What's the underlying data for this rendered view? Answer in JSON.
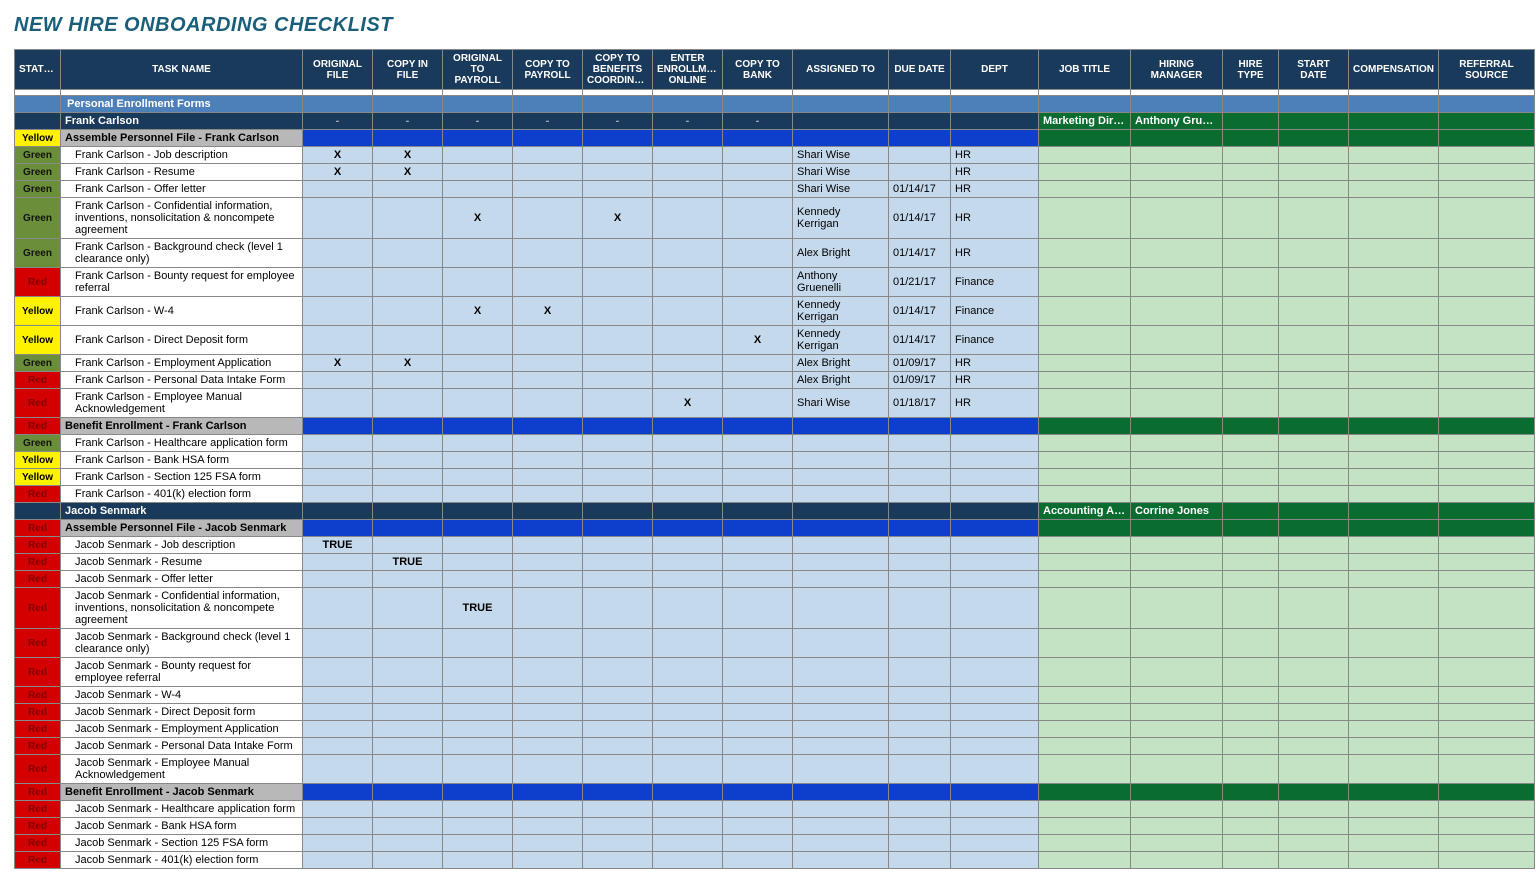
{
  "title": "NEW HIRE ONBOARDING CHECKLIST",
  "columns": [
    "STATUS",
    "TASK NAME",
    "ORIGINAL FILE",
    "COPY IN FILE",
    "ORIGINAL TO PAYROLL",
    "COPY TO PAYROLL",
    "COPY TO BENEFITS COORDINATOR",
    "ENTER ENROLLMENT ONLINE",
    "COPY TO BANK",
    "ASSIGNED TO",
    "DUE DATE",
    "DEPT",
    "JOB TITLE",
    "HIRING MANAGER",
    "HIRE TYPE",
    "START DATE",
    "COMPENSATION",
    "REFERRAL SOURCE"
  ],
  "col_classes": [
    "col-status",
    "col-task",
    "col-check",
    "col-check",
    "col-check",
    "col-check",
    "col-check",
    "col-check",
    "col-check",
    "col-assigned",
    "col-due",
    "col-dept",
    "col-job",
    "col-hmgr",
    "col-htype",
    "col-sdate",
    "col-comp",
    "col-ref"
  ],
  "section_label": "Personal Enrollment Forms",
  "persons": [
    {
      "name": "Frank Carlson",
      "job_title": "Marketing Director",
      "hiring_manager": "Anthony Gruenelli",
      "dash": "-",
      "groups": [
        {
          "status": "Yellow",
          "label": "Assemble Personnel File - Frank Carlson",
          "rows": [
            {
              "status": "Green",
              "task": "Frank Carlson - Job description",
              "checks": [
                "X",
                "X",
                "",
                "",
                "",
                "",
                ""
              ],
              "assigned": "Shari Wise",
              "due": "",
              "dept": "HR"
            },
            {
              "status": "Green",
              "task": "Frank Carlson - Resume",
              "checks": [
                "X",
                "X",
                "",
                "",
                "",
                "",
                ""
              ],
              "assigned": "Shari Wise",
              "due": "",
              "dept": "HR"
            },
            {
              "status": "Green",
              "task": "Frank Carlson - Offer letter",
              "checks": [
                "",
                "",
                "",
                "",
                "",
                "",
                ""
              ],
              "assigned": "Shari Wise",
              "due": "01/14/17",
              "dept": "HR"
            },
            {
              "status": "Green",
              "task": "Frank Carlson - Confidential information, inventions, nonsolicitation & noncompete agreement",
              "checks": [
                "",
                "",
                "X",
                "",
                "X",
                "",
                ""
              ],
              "assigned": "Kennedy Kerrigan",
              "due": "01/14/17",
              "dept": "HR"
            },
            {
              "status": "Green",
              "task": "Frank Carlson - Background check (level 1 clearance only)",
              "checks": [
                "",
                "",
                "",
                "",
                "",
                "",
                ""
              ],
              "assigned": "Alex Bright",
              "due": "01/14/17",
              "dept": "HR"
            },
            {
              "status": "Red",
              "task": "Frank Carlson - Bounty request for employee referral",
              "checks": [
                "",
                "",
                "",
                "",
                "",
                "",
                ""
              ],
              "assigned": "Anthony Gruenelli",
              "due": "01/21/17",
              "dept": "Finance"
            },
            {
              "status": "Yellow",
              "task": "Frank Carlson - W-4",
              "checks": [
                "",
                "",
                "X",
                "X",
                "",
                "",
                ""
              ],
              "assigned": "Kennedy Kerrigan",
              "due": "01/14/17",
              "dept": "Finance"
            },
            {
              "status": "Yellow",
              "task": "Frank Carlson - Direct Deposit form",
              "checks": [
                "",
                "",
                "",
                "",
                "",
                "",
                "X"
              ],
              "assigned": "Kennedy Kerrigan",
              "due": "01/14/17",
              "dept": "Finance"
            },
            {
              "status": "Green",
              "task": "Frank Carlson - Employment Application",
              "checks": [
                "X",
                "X",
                "",
                "",
                "",
                "",
                ""
              ],
              "assigned": "Alex Bright",
              "due": "01/09/17",
              "dept": "HR"
            },
            {
              "status": "Red",
              "task": "Frank Carlson - Personal Data Intake Form",
              "checks": [
                "",
                "",
                "",
                "",
                "",
                "",
                ""
              ],
              "assigned": "Alex Bright",
              "due": "01/09/17",
              "dept": "HR"
            },
            {
              "status": "Red",
              "task": "Frank Carlson - Employee Manual Acknowledgement",
              "checks": [
                "",
                "",
                "",
                "",
                "",
                "X",
                ""
              ],
              "assigned": "Shari Wise",
              "due": "01/18/17",
              "dept": "HR"
            }
          ]
        },
        {
          "status": "Red",
          "label": "Benefit Enrollment - Frank Carlson",
          "rows": [
            {
              "status": "Green",
              "task": "Frank Carlson - Healthcare application form",
              "checks": [
                "",
                "",
                "",
                "",
                "",
                "",
                ""
              ],
              "assigned": "",
              "due": "",
              "dept": ""
            },
            {
              "status": "Yellow",
              "task": "Frank Carlson - Bank HSA form",
              "checks": [
                "",
                "",
                "",
                "",
                "",
                "",
                ""
              ],
              "assigned": "",
              "due": "",
              "dept": ""
            },
            {
              "status": "Yellow",
              "task": "Frank Carlson - Section 125 FSA form",
              "checks": [
                "",
                "",
                "",
                "",
                "",
                "",
                ""
              ],
              "assigned": "",
              "due": "",
              "dept": ""
            },
            {
              "status": "Red",
              "task": "Frank Carlson - 401(k) election form",
              "checks": [
                "",
                "",
                "",
                "",
                "",
                "",
                ""
              ],
              "assigned": "",
              "due": "",
              "dept": ""
            }
          ]
        }
      ]
    },
    {
      "name": "Jacob Senmark",
      "job_title": "Accounting Associate",
      "hiring_manager": "Corrine Jones",
      "dash": "",
      "groups": [
        {
          "status": "Red",
          "label": "Assemble Personnel File - Jacob Senmark",
          "rows": [
            {
              "status": "Red",
              "task": "Jacob Senmark - Job description",
              "checks": [
                "TRUE",
                "",
                "",
                "",
                "",
                "",
                ""
              ],
              "assigned": "",
              "due": "",
              "dept": ""
            },
            {
              "status": "Red",
              "task": "Jacob Senmark - Resume",
              "checks": [
                "",
                "TRUE",
                "",
                "",
                "",
                "",
                ""
              ],
              "assigned": "",
              "due": "",
              "dept": ""
            },
            {
              "status": "Red",
              "task": "Jacob Senmark - Offer letter",
              "checks": [
                "",
                "",
                "",
                "",
                "",
                "",
                ""
              ],
              "assigned": "",
              "due": "",
              "dept": ""
            },
            {
              "status": "Red",
              "task": "Jacob Senmark - Confidential information, inventions, nonsolicitation & noncompete agreement",
              "checks": [
                "",
                "",
                "TRUE",
                "",
                "",
                "",
                ""
              ],
              "assigned": "",
              "due": "",
              "dept": ""
            },
            {
              "status": "Red",
              "task": "Jacob Senmark - Background check (level 1 clearance only)",
              "checks": [
                "",
                "",
                "",
                "",
                "",
                "",
                ""
              ],
              "assigned": "",
              "due": "",
              "dept": ""
            },
            {
              "status": "Red",
              "task": "Jacob Senmark - Bounty request for employee referral",
              "checks": [
                "",
                "",
                "",
                "",
                "",
                "",
                ""
              ],
              "assigned": "",
              "due": "",
              "dept": ""
            },
            {
              "status": "Red",
              "task": "Jacob Senmark - W-4",
              "checks": [
                "",
                "",
                "",
                "",
                "",
                "",
                ""
              ],
              "assigned": "",
              "due": "",
              "dept": ""
            },
            {
              "status": "Red",
              "task": "Jacob Senmark - Direct Deposit form",
              "checks": [
                "",
                "",
                "",
                "",
                "",
                "",
                ""
              ],
              "assigned": "",
              "due": "",
              "dept": ""
            },
            {
              "status": "Red",
              "task": "Jacob Senmark - Employment Application",
              "checks": [
                "",
                "",
                "",
                "",
                "",
                "",
                ""
              ],
              "assigned": "",
              "due": "",
              "dept": ""
            },
            {
              "status": "Red",
              "task": "Jacob Senmark - Personal Data Intake Form",
              "checks": [
                "",
                "",
                "",
                "",
                "",
                "",
                ""
              ],
              "assigned": "",
              "due": "",
              "dept": ""
            },
            {
              "status": "Red",
              "task": "Jacob Senmark - Employee Manual Acknowledgement",
              "checks": [
                "",
                "",
                "",
                "",
                "",
                "",
                ""
              ],
              "assigned": "",
              "due": "",
              "dept": ""
            }
          ]
        },
        {
          "status": "Red",
          "label": "Benefit Enrollment - Jacob Senmark",
          "rows": [
            {
              "status": "Red",
              "task": "Jacob Senmark - Healthcare application form",
              "checks": [
                "",
                "",
                "",
                "",
                "",
                "",
                ""
              ],
              "assigned": "",
              "due": "",
              "dept": ""
            },
            {
              "status": "Red",
              "task": "Jacob Senmark - Bank HSA form",
              "checks": [
                "",
                "",
                "",
                "",
                "",
                "",
                ""
              ],
              "assigned": "",
              "due": "",
              "dept": ""
            },
            {
              "status": "Red",
              "task": "Jacob Senmark - Section 125 FSA form",
              "checks": [
                "",
                "",
                "",
                "",
                "",
                "",
                ""
              ],
              "assigned": "",
              "due": "",
              "dept": ""
            },
            {
              "status": "Red",
              "task": "Jacob Senmark - 401(k) election form",
              "checks": [
                "",
                "",
                "",
                "",
                "",
                "",
                ""
              ],
              "assigned": "",
              "due": "",
              "dept": ""
            }
          ]
        }
      ]
    }
  ]
}
